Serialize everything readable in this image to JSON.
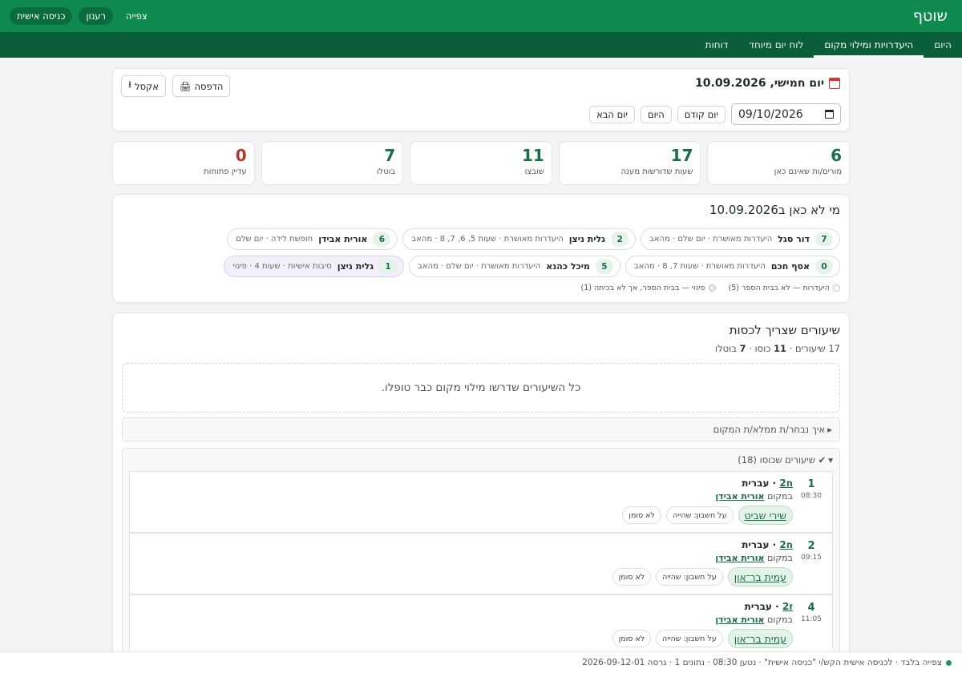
{
  "app": {
    "brand": "שוטף"
  },
  "top_actions": {
    "view_only": "צפייה",
    "refresh": "רענון",
    "personal_login": "כניסה אישית"
  },
  "tabs": [
    {
      "label": "היום",
      "active": false
    },
    {
      "label": "היעדרויות ומילוי מקום",
      "active": true
    },
    {
      "label": "לוח יום מיוחד",
      "active": false
    },
    {
      "label": "דוחות",
      "active": false
    }
  ],
  "date_card": {
    "title": "יום חמישי, 10.09.2026",
    "print": "הדפסה",
    "excel": "אקסל",
    "date_value": "09/10/2026",
    "prev_day": "יום קודם",
    "today": "היום",
    "next_day": "יום הבא"
  },
  "stats": [
    {
      "value": "6",
      "label": "מורים/ות שאינם כאן"
    },
    {
      "value": "17",
      "label": "שעות שדורשות מענה"
    },
    {
      "value": "11",
      "label": "שובצו"
    },
    {
      "value": "7",
      "label": "בוטלו"
    },
    {
      "value": "0",
      "label": "עדיין פתוחות"
    }
  ],
  "absent": {
    "title": "מי לא כאן ב10.09.2026",
    "chips": [
      {
        "count": "7",
        "name": "דור סגל",
        "detail": "היעדרות מאושרת · יום שלם · מהאב",
        "kind": "absence"
      },
      {
        "count": "2",
        "name": "גלית ניצן",
        "detail": "היעדרות מאושרת · שעות 5, 6, 7, 8 · מהאב",
        "kind": "absence"
      },
      {
        "count": "6",
        "name": "אורית אבידן",
        "detail": "חופשת לידה · יום שלם",
        "kind": "absence"
      },
      {
        "count": "0",
        "name": "אסף חכם",
        "detail": "היעדרות מאושרת · שעות 7, 8 · מהאב",
        "kind": "absence"
      },
      {
        "count": "5",
        "name": "מיכל כהנא",
        "detail": "היעדרות מאושרת · יום שלם · מהאב",
        "kind": "absence"
      },
      {
        "count": "1",
        "name": "גלית ניצן",
        "detail": "סיבות אישיות · שעות 4 · פינוי",
        "kind": "release"
      }
    ],
    "legend": [
      {
        "label": "היעדרות — לא בבית הספר (5)"
      },
      {
        "label": "פינוי — בבית הספר, אך לא בכיתה (1)"
      }
    ]
  },
  "lessons": {
    "title": "שיעורים שצריך לכסות",
    "summary_total": "17",
    "summary_total_label": "שיעורים ·",
    "summary_covered": "11",
    "summary_covered_label": "כוסו ·",
    "summary_cancelled": "7",
    "summary_cancelled_label": "בוטלו",
    "all_handled": "כל השיעורים שדרשו מילוי מקום כבר טופלו.",
    "how_chosen": "איך נבחר/ת ממלא/ת המקום",
    "covered_header": "✔ שיעורים שכוסו (18)",
    "sub_prefix": "במקום",
    "items": [
      {
        "period": "1",
        "time": "08:30",
        "class": "ח2",
        "subject": "עברית",
        "teacher": "אורית אבידן",
        "substitute": "שירי שביט",
        "tag1": "על חשבון: שהייה",
        "tag2": "לא סומן"
      },
      {
        "period": "2",
        "time": "09:15",
        "class": "ח2",
        "subject": "עברית",
        "teacher": "אורית אבידן",
        "substitute": "עמית בר־און",
        "tag1": "על חשבון: שהייה",
        "tag2": "לא סומן"
      },
      {
        "period": "4",
        "time": "11:05",
        "class": "ז2",
        "subject": "עברית",
        "teacher": "אורית אבידן",
        "substitute": "עמית בר־און",
        "tag1": "על חשבון: שהייה",
        "tag2": "לא סומן"
      }
    ]
  },
  "footer": {
    "text": "צפייה בלבד · לכניסה אישית הקש/י \"כניסה אישית\" · נטען 08:30 · נתונים 1 · גרסה 2026-09-12-01"
  },
  "colors": {
    "primary": "#0e8a4f",
    "tab_bar": "#0b5f38",
    "accent": "#1a6e47",
    "alert": "#b03a2e"
  }
}
